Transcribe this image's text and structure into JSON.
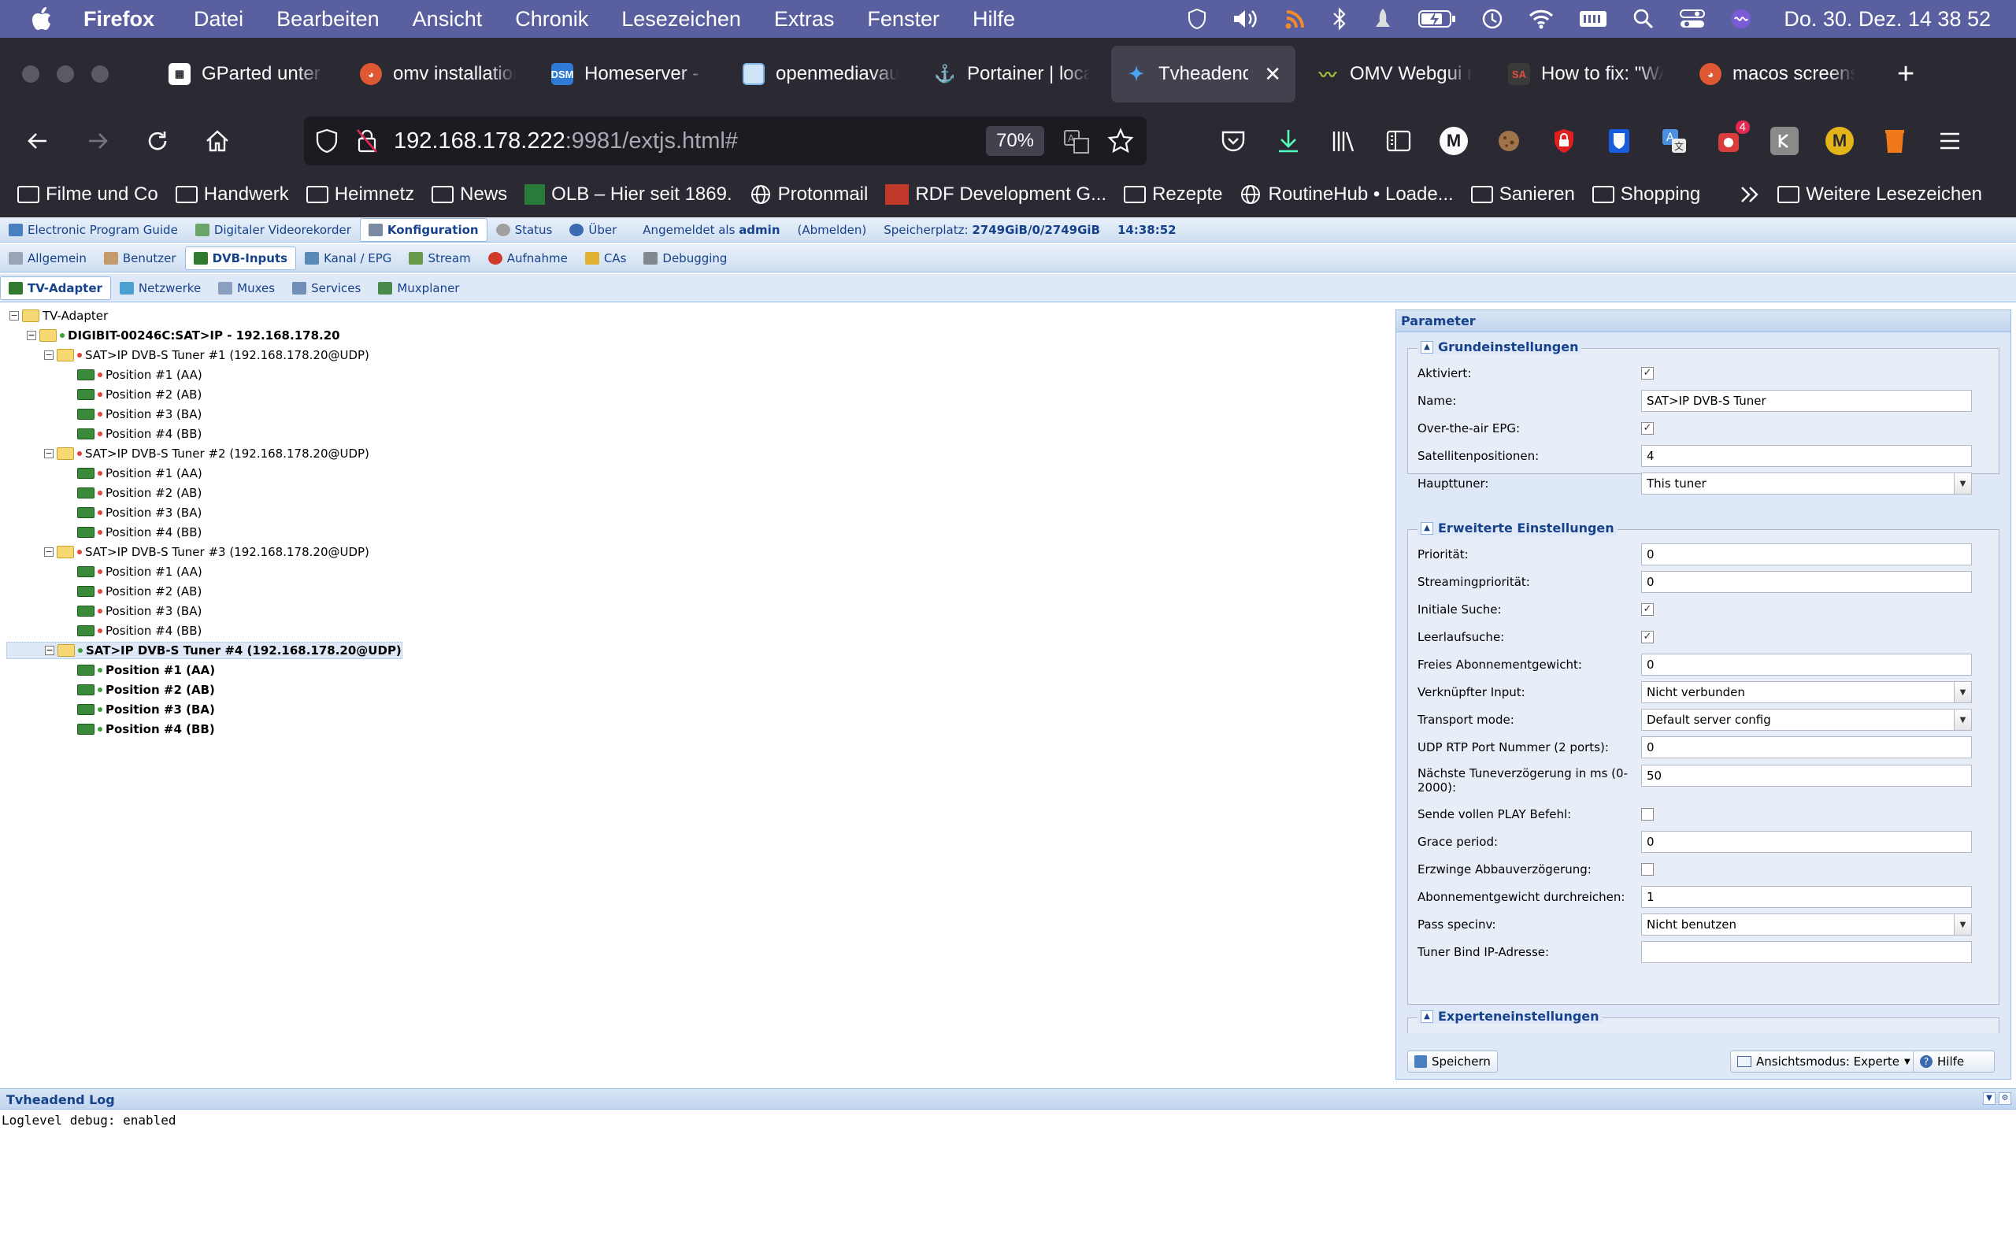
{
  "menubar": {
    "app": "Firefox",
    "items": [
      "Datei",
      "Bearbeiten",
      "Ansicht",
      "Chronik",
      "Lesezeichen",
      "Extras",
      "Fenster",
      "Hilfe"
    ],
    "clock": "Do. 30. Dez.  14 38 52"
  },
  "tabs": [
    {
      "label": "GParted unter Linux",
      "icon": "gparted-icon",
      "color": "#ffffff",
      "active": false
    },
    {
      "label": "omv installation",
      "icon": "duckduckgo-icon",
      "color": "#de5833",
      "active": false
    },
    {
      "label": "Homeserver - Synology",
      "icon": "dsm-icon",
      "color": "#2e7bd6",
      "active": false
    },
    {
      "label": "openmediavault",
      "icon": "page-icon",
      "color": "#7fb3e6",
      "active": false
    },
    {
      "label": "Portainer | local",
      "icon": "portainer-icon",
      "color": "#13bef9",
      "active": false
    },
    {
      "label": "Tvheadend",
      "icon": "tvheadend-icon",
      "color": "#4aa3f0",
      "active": true
    },
    {
      "label": "OMV Webgui not",
      "icon": "omv-icon",
      "color": "#a8c83a",
      "active": false
    },
    {
      "label": "How to fix: \"WA",
      "icon": "sa-icon",
      "color": "#c0392b",
      "active": false
    },
    {
      "label": "macos screenshot",
      "icon": "duckduckgo-icon",
      "color": "#de5833",
      "active": false
    }
  ],
  "nav": {
    "url_host": "192.168.178.222",
    "url_path": ":9981/extjs.html#",
    "zoom": "70%",
    "badge": "4",
    "avatar1": "M",
    "avatar2": "M"
  },
  "bookmarks": [
    {
      "label": "Filme und Co",
      "type": "folder"
    },
    {
      "label": "Handwerk",
      "type": "folder"
    },
    {
      "label": "Heimnetz",
      "type": "folder"
    },
    {
      "label": "News",
      "type": "folder"
    },
    {
      "label": "OLB – Hier seit 1869.",
      "type": "site"
    },
    {
      "label": "Protonmail",
      "type": "globe"
    },
    {
      "label": "RDF Development G...",
      "type": "site"
    },
    {
      "label": "Rezepte",
      "type": "folder"
    },
    {
      "label": "RoutineHub • Loade...",
      "type": "globe"
    },
    {
      "label": "Sanieren",
      "type": "folder"
    },
    {
      "label": "Shopping",
      "type": "folder"
    }
  ],
  "bookmarks_more": "Weitere Lesezeichen",
  "tvh": {
    "top_tabs": [
      "Electronic Program Guide",
      "Digitaler Videorekorder",
      "Konfiguration",
      "Status",
      "Über"
    ],
    "login_prefix": "Angemeldet als",
    "user": "admin",
    "logout": "(Abmelden)",
    "storage_label": "Speicherplatz:",
    "storage_value": "2749GiB/0/2749GiB",
    "time": "14:38:52",
    "config_tabs": [
      "Allgemein",
      "Benutzer",
      "DVB-Inputs",
      "Kanal / EPG",
      "Stream",
      "Aufnahme",
      "CAs",
      "Debugging"
    ],
    "dvb_tabs": [
      "TV-Adapter",
      "Netzwerke",
      "Muxes",
      "Services",
      "Muxplaner"
    ],
    "tree": {
      "root": "TV-Adapter",
      "device": "DIGIBIT-00246C:SAT>IP - 192.168.178.20",
      "tuners": [
        {
          "label": "SAT>IP DVB-S Tuner #1 (192.168.178.20@UDP)",
          "positions": [
            "Position #1 (AA)",
            "Position #2 (AB)",
            "Position #3 (BA)",
            "Position #4 (BB)"
          ]
        },
        {
          "label": "SAT>IP DVB-S Tuner #2 (192.168.178.20@UDP)",
          "positions": [
            "Position #1 (AA)",
            "Position #2 (AB)",
            "Position #3 (BA)",
            "Position #4 (BB)"
          ]
        },
        {
          "label": "SAT>IP DVB-S Tuner #3 (192.168.178.20@UDP)",
          "positions": [
            "Position #1 (AA)",
            "Position #2 (AB)",
            "Position #3 (BA)",
            "Position #4 (BB)"
          ]
        },
        {
          "label": "SAT>IP DVB-S Tuner #4 (192.168.178.20@UDP)",
          "positions": [
            "Position #1 (AA)",
            "Position #2 (AB)",
            "Position #3 (BA)",
            "Position #4 (BB)"
          ]
        }
      ]
    },
    "params": {
      "title": "Parameter",
      "basic_title": "Grundeinstellungen",
      "basic": [
        {
          "label": "Aktiviert:",
          "type": "check",
          "value": true
        },
        {
          "label": "Name:",
          "type": "text",
          "value": "SAT>IP DVB-S Tuner"
        },
        {
          "label": "Over-the-air EPG:",
          "type": "check",
          "value": true
        },
        {
          "label": "Satellitenpositionen:",
          "type": "text",
          "value": "4"
        },
        {
          "label": "Haupttuner:",
          "type": "select",
          "value": "This tuner"
        }
      ],
      "adv_title": "Erweiterte Einstellungen",
      "advanced": [
        {
          "label": "Priorität:",
          "type": "text",
          "value": "0"
        },
        {
          "label": "Streamingpriorität:",
          "type": "text",
          "value": "0"
        },
        {
          "label": "Initiale Suche:",
          "type": "check",
          "value": true
        },
        {
          "label": "Leerlaufsuche:",
          "type": "check",
          "value": true
        },
        {
          "label": "Freies Abonnementgewicht:",
          "type": "text",
          "value": "0"
        },
        {
          "label": "Verknüpfter Input:",
          "type": "select",
          "value": "Nicht verbunden"
        },
        {
          "label": "Transport mode:",
          "type": "select",
          "value": "Default server config"
        },
        {
          "label": "UDP RTP Port Nummer (2 ports):",
          "type": "text",
          "value": "0"
        },
        {
          "label": "Nächste Tuneverzögerung in ms (0-2000):",
          "type": "text",
          "value": "50"
        },
        {
          "label": "Sende vollen PLAY Befehl:",
          "type": "check",
          "value": false
        },
        {
          "label": "Grace period:",
          "type": "text",
          "value": "0"
        },
        {
          "label": "Erzwinge Abbauverzögerung:",
          "type": "check",
          "value": false
        },
        {
          "label": "Abonnementgewicht durchreichen:",
          "type": "text",
          "value": "1"
        },
        {
          "label": "Pass specinv:",
          "type": "select",
          "value": "Nicht benutzen"
        },
        {
          "label": "Tuner Bind IP-Adresse:",
          "type": "text",
          "value": ""
        }
      ],
      "expert_title": "Experteneinstellungen",
      "save": "Speichern",
      "view_mode": "Ansichtsmodus: Experte",
      "help": "Hilfe"
    },
    "log_title": "Tvheadend Log",
    "log_text": "Loglevel debug: enabled"
  }
}
